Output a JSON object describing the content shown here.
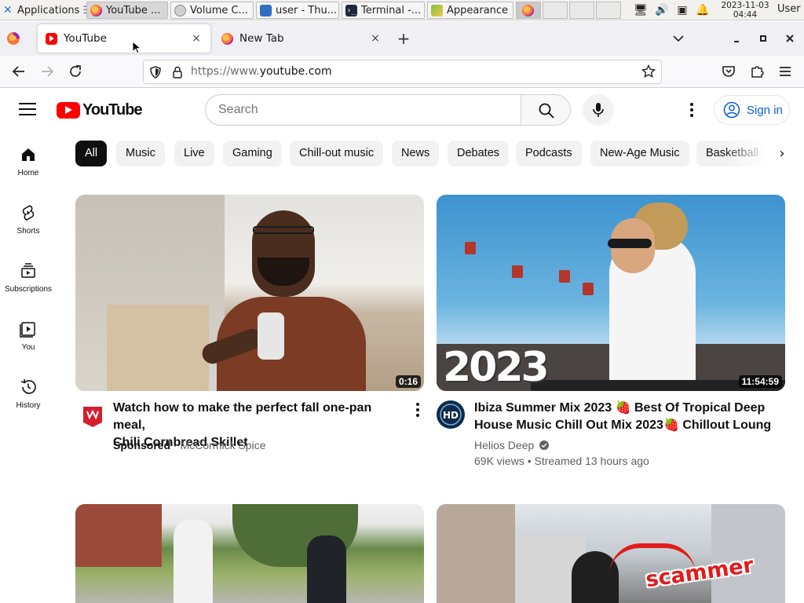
{
  "os_panel": {
    "applications_label": "Applications",
    "tasks": [
      {
        "label": "YouTube ...",
        "icon": "firefox-icon"
      },
      {
        "label": "Volume C...",
        "icon": "volume-icon"
      },
      {
        "label": "user - Thu...",
        "icon": "file-manager-icon"
      },
      {
        "label": "Terminal -...",
        "icon": "terminal-icon"
      },
      {
        "label": "Appearance",
        "icon": "appearance-icon"
      }
    ],
    "clock_date": "2023-11-03",
    "clock_time": "04:44",
    "user": "User"
  },
  "browser": {
    "tabs": [
      {
        "title": "YouTube",
        "selected": true
      },
      {
        "title": "New Tab",
        "selected": false
      }
    ],
    "close_glyph": "×",
    "new_tab_glyph": "+",
    "url_prefix": "https://www.",
    "url_domain": "youtube.com"
  },
  "youtube": {
    "logo_text": "YouTube",
    "search_placeholder": "Search",
    "sign_in_label": "Sign in",
    "guide": [
      {
        "label": "Home",
        "icon": "home-icon"
      },
      {
        "label": "Shorts",
        "icon": "shorts-icon"
      },
      {
        "label": "Subscriptions",
        "icon": "subscriptions-icon"
      },
      {
        "label": "You",
        "icon": "you-icon"
      },
      {
        "label": "History",
        "icon": "history-icon"
      }
    ],
    "chips": [
      "All",
      "Music",
      "Live",
      "Gaming",
      "Chill-out music",
      "News",
      "Debates",
      "Podcasts",
      "New-Age Music",
      "Basketball"
    ],
    "chip_next_glyph": "›",
    "videos": [
      {
        "title_line1": "Watch how to make the perfect fall one-pan meal,",
        "title_line2": "Chili Cornbread Skillet",
        "duration": "0:16",
        "sponsored_label": "Sponsored",
        "channel": "McCormick Spice"
      },
      {
        "title_line1": "Ibiza Summer Mix 2023 🍓 Best Of Tropical Deep",
        "title_line2": "House Music Chill Out Mix 2023🍓 Chillout Loung…",
        "duration": "11:54:59",
        "channel": "Helios Deep",
        "stats": "69K views • Streamed 13 hours ago",
        "thumb_text": "2023"
      },
      {},
      {
        "thumb_text": "scammer"
      }
    ]
  }
}
